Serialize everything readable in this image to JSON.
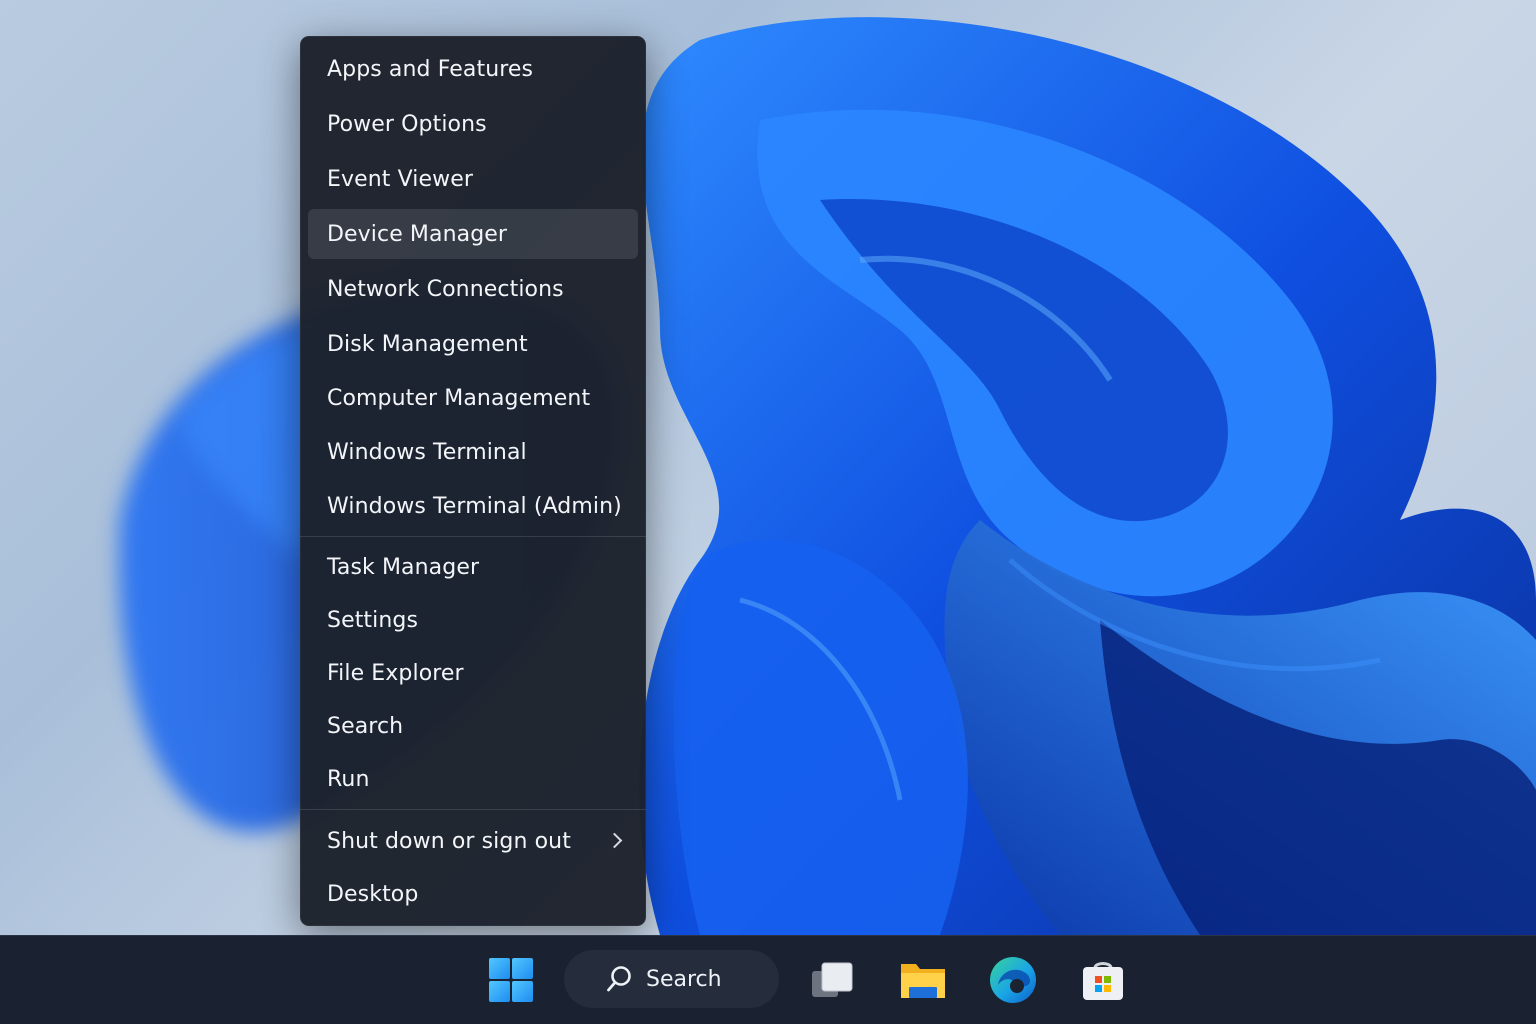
{
  "menu": {
    "items": [
      {
        "label": "Apps and Features"
      },
      {
        "label": "Power Options"
      },
      {
        "label": "Event Viewer"
      },
      {
        "label": "Device Manager",
        "selected": true
      },
      {
        "label": "Network Connections"
      },
      {
        "label": "Disk Management"
      },
      {
        "label": "Computer Management"
      },
      {
        "label": "Windows Terminal"
      },
      {
        "label": "Windows Terminal (Admin)"
      },
      {
        "label": "Task Manager"
      },
      {
        "label": "Settings"
      },
      {
        "label": "File Explorer"
      },
      {
        "label": "Search"
      },
      {
        "label": "Run"
      },
      {
        "label": "Shut down or sign out",
        "submenu": true
      },
      {
        "label": "Desktop"
      }
    ]
  },
  "taskbar": {
    "search_label": "Search",
    "icons": [
      "windows-start-icon",
      "search-icon",
      "task-view-icon",
      "file-explorer-icon",
      "edge-icon",
      "store-icon"
    ]
  },
  "colors": {
    "menu_bg": "#1c212b",
    "taskbar_bg": "#1a2130",
    "accent": "#1e6fff"
  }
}
